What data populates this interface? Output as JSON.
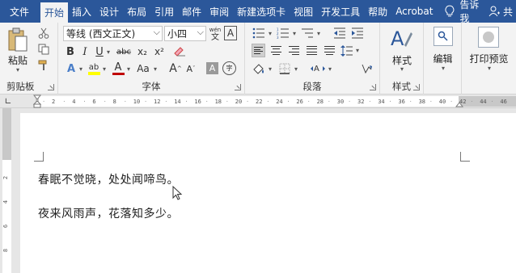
{
  "tabs": [
    {
      "label": "文件",
      "active": false
    },
    {
      "label": "开始",
      "active": true
    },
    {
      "label": "插入",
      "active": false
    },
    {
      "label": "设计",
      "active": false
    },
    {
      "label": "布局",
      "active": false
    },
    {
      "label": "引用",
      "active": false
    },
    {
      "label": "邮件",
      "active": false
    },
    {
      "label": "审阅",
      "active": false
    },
    {
      "label": "新建选项卡",
      "active": false
    },
    {
      "label": "视图",
      "active": false
    },
    {
      "label": "开发工具",
      "active": false
    },
    {
      "label": "帮助",
      "active": false
    },
    {
      "label": "Acrobat",
      "active": false
    }
  ],
  "tellme": {
    "label": "告诉我"
  },
  "share": {
    "label": "共"
  },
  "clipboard": {
    "paste_label": "粘贴",
    "group_label": "剪贴板"
  },
  "font": {
    "name": "等线 (西文正文)",
    "size": "小四",
    "group_label": "字体",
    "wen_glyph": "文",
    "a_box_glyph": "A",
    "bold": "B",
    "italic": "I",
    "underline": "U",
    "strike": "abc",
    "subscript": "x₂",
    "superscript": "x²",
    "effects_glyph": "A",
    "highlight_glyph": "ab",
    "fontcolor_glyph": "A",
    "case_glyph": "Aa",
    "grow_glyph": "A",
    "shrink_glyph": "A",
    "shade_glyph": "A",
    "circle_glyph": "字"
  },
  "paragraph": {
    "group_label": "段落"
  },
  "styles": {
    "label": "样式",
    "group_label": "样式"
  },
  "editing": {
    "label": "编辑"
  },
  "print_preview": {
    "label": "打印预览"
  },
  "ruler": {
    "ticks": [
      "2",
      "4",
      "6",
      "8",
      "10",
      "12",
      "14",
      "16",
      "18",
      "20",
      "22",
      "24",
      "26",
      "28",
      "30",
      "32",
      "34",
      "36",
      "38",
      "40",
      "42",
      "44",
      "46"
    ]
  },
  "vruler": {
    "ticks": [
      "2",
      "4",
      "6",
      "8"
    ]
  },
  "document": {
    "lines": [
      "春眠不觉晓，处处闻啼鸟。",
      "夜来风雨声，花落知多少。"
    ]
  },
  "colors": {
    "tab_bar": "#2b579a",
    "ribbon": "#f3f3f3",
    "highlight_yellow": "#ffff00",
    "font_red": "#c00000",
    "styles_blue": "#2b579a"
  }
}
